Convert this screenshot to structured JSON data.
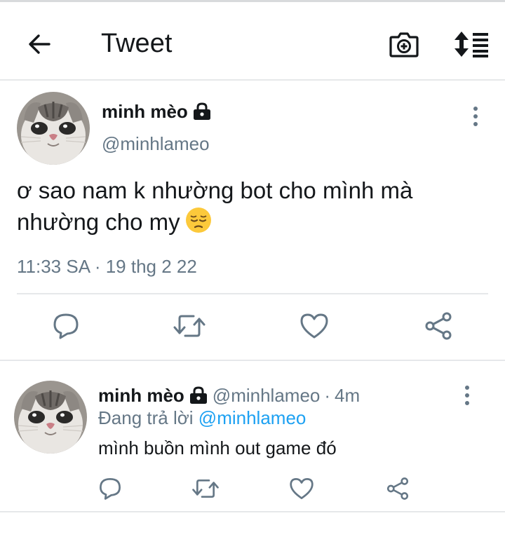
{
  "colors": {
    "text_primary": "#14171a",
    "text_secondary": "#657786",
    "accent_link": "#1da1f2",
    "divider": "#e6e8ea"
  },
  "header": {
    "title": "Tweet",
    "icons": [
      "back-arrow-icon",
      "camera-add-icon",
      "sort-list-icon"
    ]
  },
  "main_tweet": {
    "author_name": "minh mèo",
    "handle": "@minhlameo",
    "text": "ơ sao nam k nhường bot cho mình mà nhường cho my",
    "emoji": "pensive-face",
    "timestamp": "11:33 SA · 19 thg 2 22",
    "icons": [
      "lock-icon",
      "more-vertical-icon",
      "reply-icon",
      "retweet-icon",
      "like-icon",
      "share-icon"
    ]
  },
  "reply_tweet": {
    "author_name": "minh mèo",
    "handle": "@minhlameo",
    "separator": "·",
    "time_ago": "4m",
    "replying_prefix": "Đang trả lời",
    "replying_to": "@minhlameo",
    "text": "mình buồn mình out game đó",
    "icons": [
      "lock-icon",
      "more-vertical-icon",
      "reply-icon",
      "retweet-icon",
      "like-icon",
      "share-icon"
    ]
  }
}
